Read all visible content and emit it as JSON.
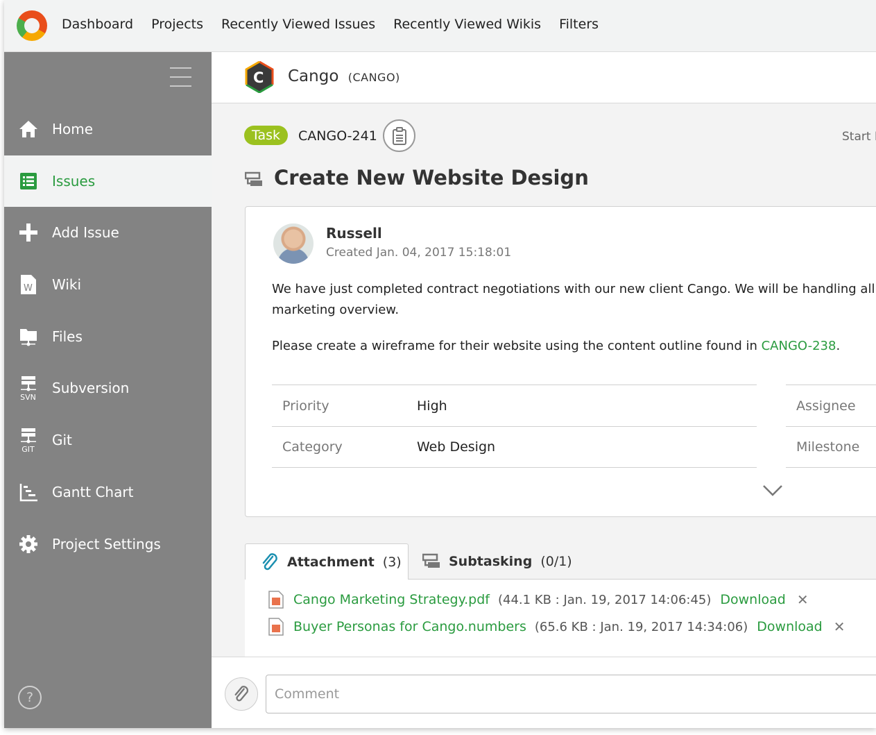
{
  "topnav": {
    "links": [
      "Dashboard",
      "Projects",
      "Recently Viewed Issues",
      "Recently Viewed Wikis",
      "Filters"
    ]
  },
  "sidebar": {
    "items": [
      {
        "label": "Home",
        "icon": "home-icon"
      },
      {
        "label": "Issues",
        "icon": "issues-list-icon",
        "active": true
      },
      {
        "label": "Add Issue",
        "icon": "plus-icon"
      },
      {
        "label": "Wiki",
        "icon": "wiki-document-icon"
      },
      {
        "label": "Files",
        "icon": "folder-icon"
      },
      {
        "label": "Subversion",
        "icon": "svn-icon",
        "sub": "SVN"
      },
      {
        "label": "Git",
        "icon": "git-icon",
        "sub": "GIT"
      },
      {
        "label": "Gantt Chart",
        "icon": "gantt-chart-icon"
      },
      {
        "label": "Project Settings",
        "icon": "gear-icon"
      }
    ],
    "help": "?"
  },
  "project": {
    "name": "Cango",
    "key": "(CANGO)",
    "logo_letter": "C"
  },
  "issue": {
    "type": "Task",
    "key": "CANGO-241",
    "start_label": "Start I",
    "title": "Create New Website Design",
    "author": "Russell",
    "created_label": "Created",
    "created_date": "Jan. 04, 2017 15:18:01",
    "description_1": "We have just completed contract negotiations with our new client Cango. We will be handling all marketing overview.",
    "description_2_prefix": "Please create a wireframe for their website using the content outline found in ",
    "description_2_link": "CANGO-238",
    "description_2_suffix": ".",
    "fields": [
      {
        "label": "Priority",
        "value": "High"
      },
      {
        "label": "Category",
        "value": "Web Design"
      }
    ],
    "fields_right": [
      {
        "label": "Assignee"
      },
      {
        "label": "Milestone"
      }
    ]
  },
  "tabs": {
    "attachment": {
      "label": "Attachment",
      "count": "(3)"
    },
    "subtasking": {
      "label": "Subtasking",
      "count": "(0/1)"
    }
  },
  "attachments": [
    {
      "name": "Cango Marketing Strategy.pdf",
      "meta": "(44.1 KB : Jan. 19, 2017 14:06:45)",
      "download": "Download"
    },
    {
      "name": "Buyer Personas for Cango.numbers",
      "meta": "(65.6 KB : Jan. 19, 2017 14:34:06)",
      "download": "Download"
    }
  ],
  "comment": {
    "placeholder": "Comment"
  },
  "colors": {
    "accent_green": "#2a9b3f",
    "task_badge": "#9bc11f",
    "sidebar_bg": "#838383"
  }
}
